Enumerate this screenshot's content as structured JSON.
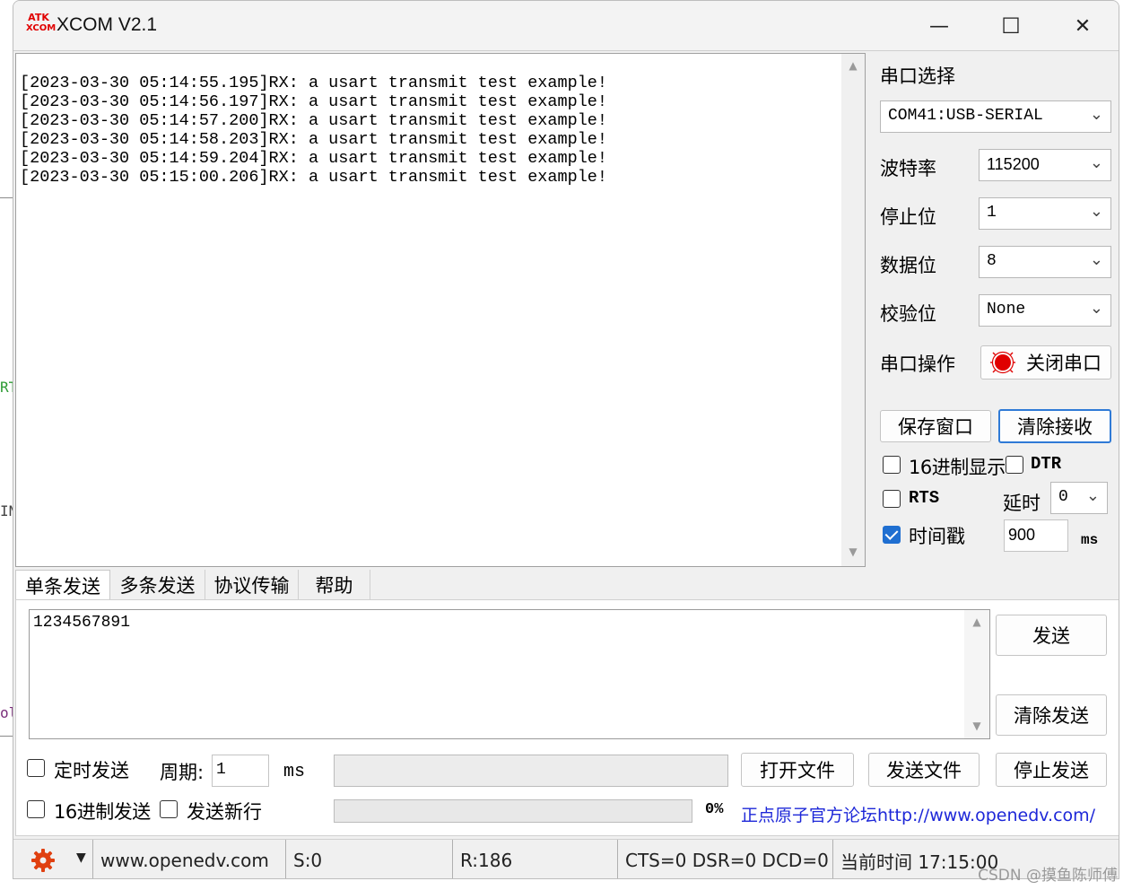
{
  "app": {
    "logo_top": "ATK",
    "logo_bottom": "XCOM",
    "title": "XCOM V2.1"
  },
  "window_controls": {
    "minimize": "—",
    "maximize": "☐",
    "close": "✕"
  },
  "background_fragments": [
    "RT",
    "IN",
    "ol"
  ],
  "receive_log": [
    "[2023-03-30 05:14:55.195]RX: a usart transmit test example!",
    "[2023-03-30 05:14:56.197]RX: a usart transmit test example!",
    "[2023-03-30 05:14:57.200]RX: a usart transmit test example!",
    "[2023-03-30 05:14:58.203]RX: a usart transmit test example!",
    "[2023-03-30 05:14:59.204]RX: a usart transmit test example!",
    "[2023-03-30 05:15:00.206]RX: a usart transmit test example!"
  ],
  "port_panel": {
    "title": "串口选择",
    "port_value": "COM41:USB-SERIAL",
    "baud_label": "波特率",
    "baud_value": "115200",
    "stop_label": "停止位",
    "stop_value": "1",
    "data_label": "数据位",
    "data_value": "8",
    "parity_label": "校验位",
    "parity_value": "None",
    "op_label": "串口操作",
    "op_button": "关闭串口",
    "save_button": "保存窗口",
    "clear_recv_button": "清除接收",
    "hex_display_label": "16进制显示",
    "hex_display_checked": false,
    "dtr_label": "DTR",
    "dtr_checked": false,
    "rts_label": "RTS",
    "rts_checked": false,
    "delay_label": "延时",
    "delay_value": "0",
    "timestamp_label": "时间戳",
    "timestamp_checked": true,
    "timestamp_value": "900",
    "timestamp_unit": "ms"
  },
  "tabs": [
    {
      "label": "单条发送",
      "active": true
    },
    {
      "label": "多条发送",
      "active": false
    },
    {
      "label": "协议传输",
      "active": false
    },
    {
      "label": "帮助",
      "active": false
    }
  ],
  "send": {
    "text": "1234567891",
    "send_button": "发送",
    "clear_send_button": "清除发送",
    "timed_send_label": "定时发送",
    "timed_send_checked": false,
    "period_label": "周期:",
    "period_value": "1",
    "period_unit": "ms",
    "open_file_button": "打开文件",
    "send_file_button": "发送文件",
    "stop_send_button": "停止发送",
    "hex_send_label": "16进制发送",
    "hex_send_checked": false,
    "newline_label": "发送新行",
    "newline_checked": false,
    "progress_text": "0%",
    "progress": 0,
    "forum_link": "正点原子官方论坛http://www.openedv.com/"
  },
  "statusbar": {
    "url": "www.openedv.com",
    "sent": "S:0",
    "received": "R:186",
    "lines": "CTS=0 DSR=0 DCD=0",
    "time": "当前时间 17:15:00"
  },
  "watermark": "CSDN @摸鱼陈师傅",
  "colors": {
    "accent": "#1f6fd1",
    "link": "#1d27d8",
    "indicator_red": "#e00000",
    "focus_border": "#2f7ad6",
    "settings_icon": "#e04010"
  }
}
